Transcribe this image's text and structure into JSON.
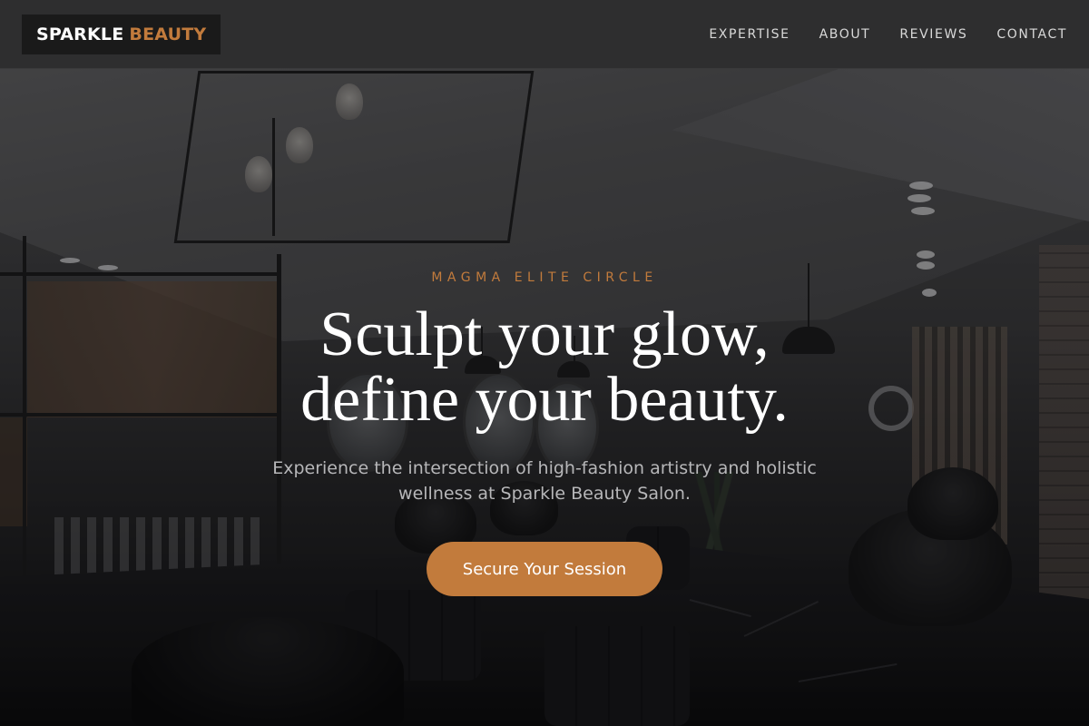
{
  "nav": {
    "brand_primary": "SPARKLE",
    "brand_accent": "BEAUTY",
    "links": [
      {
        "label": "EXPERTISE"
      },
      {
        "label": "ABOUT"
      },
      {
        "label": "REVIEWS"
      },
      {
        "label": "CONTACT"
      }
    ]
  },
  "hero": {
    "eyebrow": "MAGMA ELITE CIRCLE",
    "headline_line1": "Sculpt your glow,",
    "headline_line2": "define your beauty.",
    "subtext": "Experience the intersection of high-fashion artistry and holistic wellness at Sparkle Beauty Salon.",
    "cta_label": "Secure Your Session",
    "background": "salon interior photo"
  },
  "colors": {
    "accent": "#c27b3c",
    "navbar_bg": "#2e2e2f",
    "logo_bg": "#1a1a1a",
    "text_light": "#ffffff",
    "subtext": "#b7b7b9"
  }
}
